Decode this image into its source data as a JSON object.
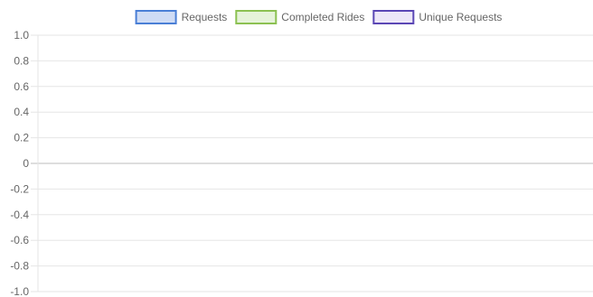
{
  "chart_data": {
    "type": "line",
    "categories": [],
    "series": [
      {
        "name": "Requests",
        "values": [],
        "border_color": "#4a7fd6",
        "fill_color": "#cfdcf5"
      },
      {
        "name": "Completed Rides",
        "values": [],
        "border_color": "#8cc152",
        "fill_color": "#e6f3da"
      },
      {
        "name": "Unique Requests",
        "values": [],
        "border_color": "#5b47b5",
        "fill_color": "#ede7f8"
      }
    ],
    "ylim": [
      -1.0,
      1.0
    ],
    "yticks": [
      "1.0",
      "0.8",
      "0.6",
      "0.4",
      "0.2",
      "0",
      "-0.2",
      "-0.4",
      "-0.6",
      "-0.8",
      "-1.0"
    ],
    "grid": true,
    "legend_position": "top"
  }
}
